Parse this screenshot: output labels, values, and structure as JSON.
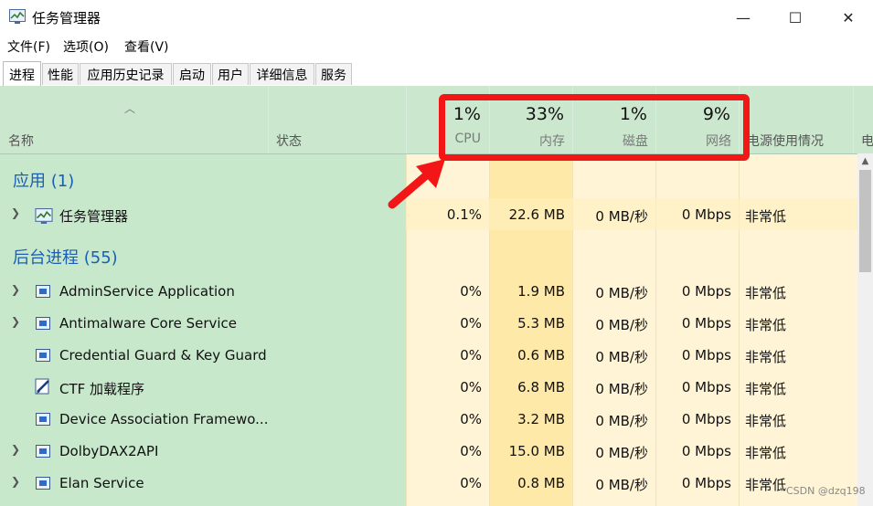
{
  "window": {
    "title": "任务管理器",
    "buttons": {
      "minimize": "—",
      "maximize": "☐",
      "close": "✕"
    }
  },
  "menu": [
    "文件(F)",
    "选项(O)",
    "查看(V)"
  ],
  "tabs": [
    "进程",
    "性能",
    "应用历史记录",
    "启动",
    "用户",
    "详细信息",
    "服务"
  ],
  "header": {
    "name_label": "名称",
    "status_label": "状态",
    "cpu_pct": "1%",
    "cpu_label": "CPU",
    "mem_pct": "33%",
    "mem_label": "内存",
    "disk_pct": "1%",
    "disk_label": "磁盘",
    "net_pct": "9%",
    "net_label": "网络",
    "power_label": "电源使用情况",
    "power_trend_label": "电"
  },
  "groups": {
    "apps": "应用 (1)",
    "background": "后台进程 (55)"
  },
  "app_rows": [
    {
      "name": "任务管理器",
      "cpu": "0.1%",
      "mem": "22.6 MB",
      "disk": "0 MB/秒",
      "net": "0 Mbps",
      "power": "非常低",
      "expandable": true,
      "icon": "taskmgr-icon"
    }
  ],
  "bg_rows": [
    {
      "name": "AdminService Application",
      "cpu": "0%",
      "mem": "1.9 MB",
      "disk": "0 MB/秒",
      "net": "0 Mbps",
      "power": "非常低",
      "expandable": true,
      "icon": "service-window-icon"
    },
    {
      "name": "Antimalware Core Service",
      "cpu": "0%",
      "mem": "5.3 MB",
      "disk": "0 MB/秒",
      "net": "0 Mbps",
      "power": "非常低",
      "expandable": true,
      "icon": "service-window-icon"
    },
    {
      "name": "Credential Guard & Key Guard",
      "cpu": "0%",
      "mem": "0.6 MB",
      "disk": "0 MB/秒",
      "net": "0 Mbps",
      "power": "非常低",
      "expandable": false,
      "icon": "service-window-icon"
    },
    {
      "name": "CTF 加载程序",
      "cpu": "0%",
      "mem": "6.8 MB",
      "disk": "0 MB/秒",
      "net": "0 Mbps",
      "power": "非常低",
      "expandable": false,
      "icon": "ctf-pen-icon"
    },
    {
      "name": "Device Association Framewo...",
      "cpu": "0%",
      "mem": "3.2 MB",
      "disk": "0 MB/秒",
      "net": "0 Mbps",
      "power": "非常低",
      "expandable": false,
      "icon": "service-window-icon"
    },
    {
      "name": "DolbyDAX2API",
      "cpu": "0%",
      "mem": "15.0 MB",
      "disk": "0 MB/秒",
      "net": "0 Mbps",
      "power": "非常低",
      "expandable": true,
      "icon": "service-window-icon"
    },
    {
      "name": "Elan Service",
      "cpu": "0%",
      "mem": "0.8 MB",
      "disk": "0 MB/秒",
      "net": "0 Mbps",
      "power": "非常低",
      "expandable": true,
      "icon": "service-window-icon"
    }
  ],
  "colors": {
    "green_panel": "#c8e8cc",
    "yellow_light": "#fff4d6",
    "yellow_mem": "#ffe9a8",
    "annotation_red": "#f21616",
    "group_blue": "#1a5fb4"
  },
  "watermark": "CSDN @dzq198"
}
